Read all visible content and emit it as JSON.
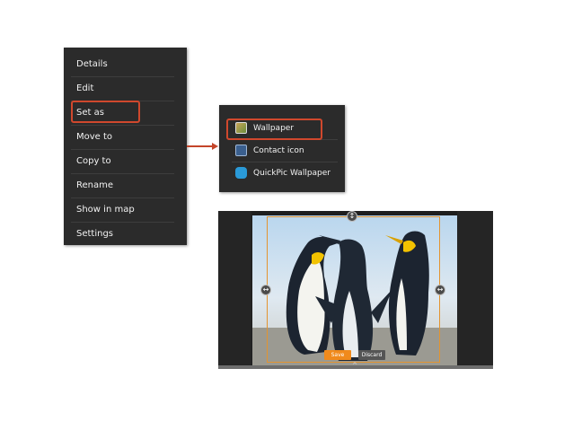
{
  "context_menu": {
    "items": [
      {
        "label": "Details"
      },
      {
        "label": "Edit"
      },
      {
        "label": "Set as"
      },
      {
        "label": "Move to"
      },
      {
        "label": "Copy to"
      },
      {
        "label": "Rename"
      },
      {
        "label": "Show in map"
      },
      {
        "label": "Settings"
      }
    ],
    "highlighted": "Set as"
  },
  "set_as_menu": {
    "items": [
      {
        "label": "Wallpaper",
        "icon": "gallery-icon"
      },
      {
        "label": "Contact icon",
        "icon": "contact-icon"
      },
      {
        "label": "QuickPic Wallpaper",
        "icon": "quickpic-icon"
      }
    ],
    "highlighted": "Wallpaper"
  },
  "crop_editor": {
    "save_label": "Save",
    "discard_label": "Discard"
  },
  "colors": {
    "highlight": "#d0482d",
    "crop_frame": "#e39430",
    "save_button": "#f08a1c",
    "menu_background": "#2b2b2b"
  }
}
